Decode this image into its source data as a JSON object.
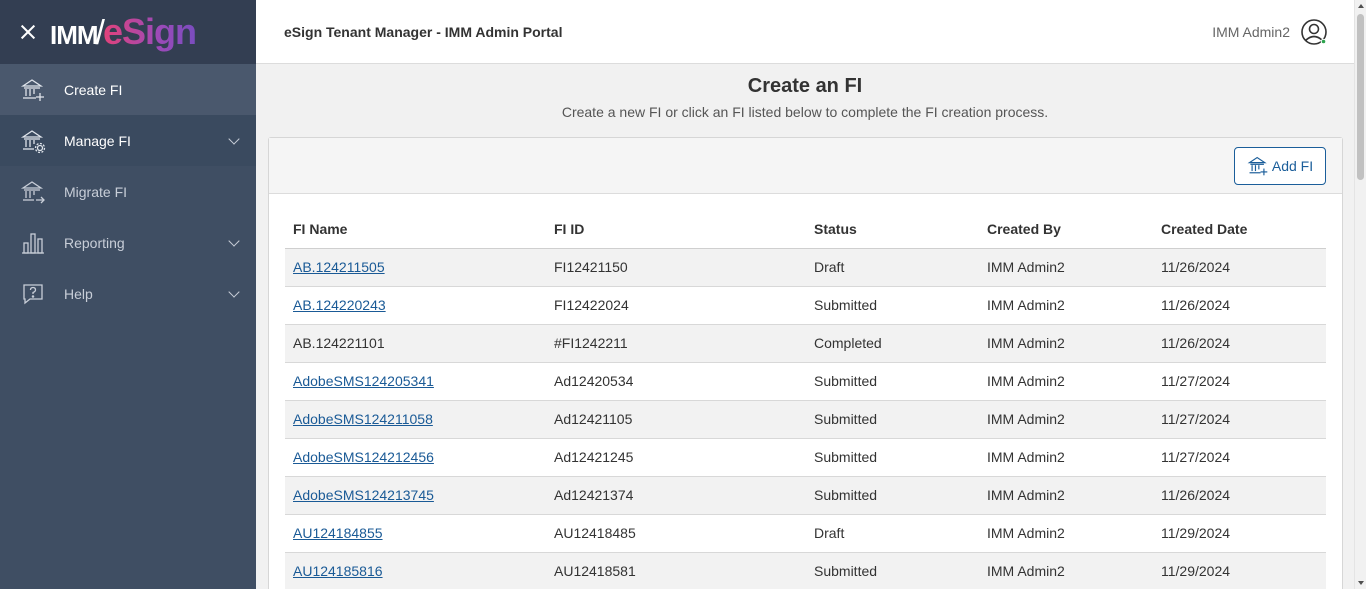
{
  "brand": {
    "imm": "IMM",
    "slash": "/",
    "esign": "eSign"
  },
  "sidebar": {
    "items": [
      {
        "label": "Create FI",
        "icon": "bank-add-icon",
        "has_chevron": false
      },
      {
        "label": "Manage FI",
        "icon": "bank-gear-icon",
        "has_chevron": true
      },
      {
        "label": "Migrate FI",
        "icon": "bank-arrow-icon",
        "has_chevron": false
      },
      {
        "label": "Reporting",
        "icon": "bar-chart-icon",
        "has_chevron": true
      },
      {
        "label": "Help",
        "icon": "help-icon",
        "has_chevron": true
      }
    ]
  },
  "header": {
    "title": "eSign Tenant Manager - IMM Admin Portal",
    "user_name": "IMM Admin2"
  },
  "main": {
    "title": "Create an FI",
    "subtitle": "Create a new FI or click an FI listed below to complete the FI creation process.",
    "add_button_label": "Add FI"
  },
  "table": {
    "columns": [
      "FI Name",
      "FI ID",
      "Status",
      "Created By",
      "Created Date"
    ],
    "rows": [
      {
        "name": "AB.124211505",
        "id": "FI12421150",
        "status": "Draft",
        "created_by": "IMM Admin2",
        "created_date": "11/26/2024",
        "link": true
      },
      {
        "name": "AB.124220243",
        "id": "FI12422024",
        "status": "Submitted",
        "created_by": "IMM Admin2",
        "created_date": "11/26/2024",
        "link": true
      },
      {
        "name": "AB.124221101",
        "id": "#FI1242211",
        "status": "Completed",
        "created_by": "IMM Admin2",
        "created_date": "11/26/2024",
        "link": false
      },
      {
        "name": "AdobeSMS124205341",
        "id": "Ad12420534",
        "status": "Submitted",
        "created_by": "IMM Admin2",
        "created_date": "11/27/2024",
        "link": true
      },
      {
        "name": "AdobeSMS124211058",
        "id": "Ad12421105",
        "status": "Submitted",
        "created_by": "IMM Admin2",
        "created_date": "11/27/2024",
        "link": true
      },
      {
        "name": "AdobeSMS124212456",
        "id": "Ad12421245",
        "status": "Submitted",
        "created_by": "IMM Admin2",
        "created_date": "11/27/2024",
        "link": true
      },
      {
        "name": "AdobeSMS124213745",
        "id": "Ad12421374",
        "status": "Submitted",
        "created_by": "IMM Admin2",
        "created_date": "11/26/2024",
        "link": true
      },
      {
        "name": "AU124184855",
        "id": "AU12418485",
        "status": "Draft",
        "created_by": "IMM Admin2",
        "created_date": "11/29/2024",
        "link": true
      },
      {
        "name": "AU124185816",
        "id": "AU12418581",
        "status": "Submitted",
        "created_by": "IMM Admin2",
        "created_date": "11/29/2024",
        "link": true
      }
    ]
  },
  "colors": {
    "sidebar_bg": "#3f4e63",
    "brand_bg": "#333e52",
    "link": "#1a5a96",
    "accent": "#1b5e9a"
  }
}
